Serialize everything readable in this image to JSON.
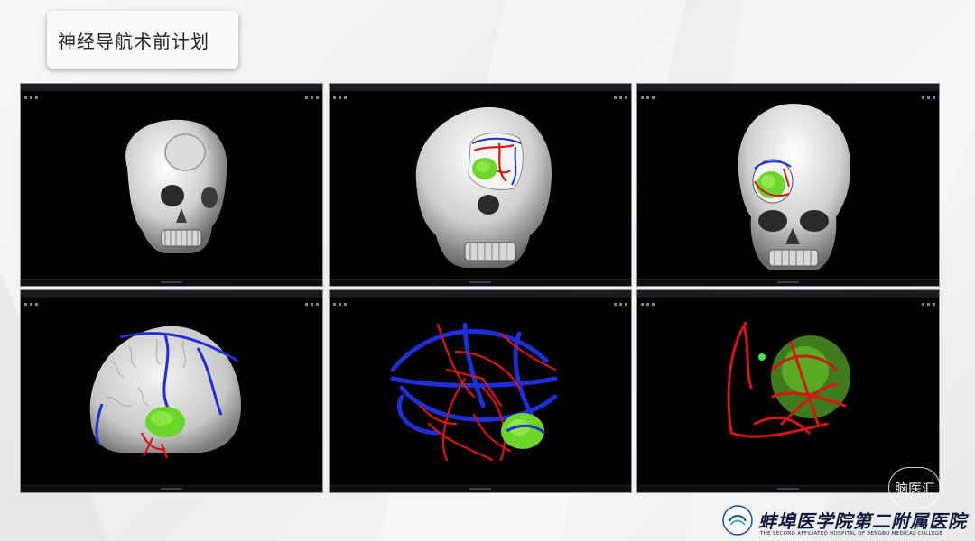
{
  "slide": {
    "title": "神经导航术前计划"
  },
  "panels": [
    {
      "name": "skull-oblique-craniotomy"
    },
    {
      "name": "skull-oblique-vessels-tumor"
    },
    {
      "name": "skull-frontal-vessels-tumor"
    },
    {
      "name": "brain-surface-tumor-veins"
    },
    {
      "name": "vessels-arteries-veins-tumor"
    },
    {
      "name": "arteries-tumor-closeup"
    }
  ],
  "colors": {
    "artery": "#d81515",
    "vein": "#1f2fd8",
    "tumor": "#6dd62a",
    "bone": "#e6e6e6",
    "panel_bg": "#000000"
  },
  "footer": {
    "hospital_cn": "蚌埠医学院第二附属医院",
    "hospital_en": "THE SECOND AFFILIATED HOSPITAL OF BENGBU MEDICAL COLLEGE",
    "watermark": "脑医汇"
  }
}
